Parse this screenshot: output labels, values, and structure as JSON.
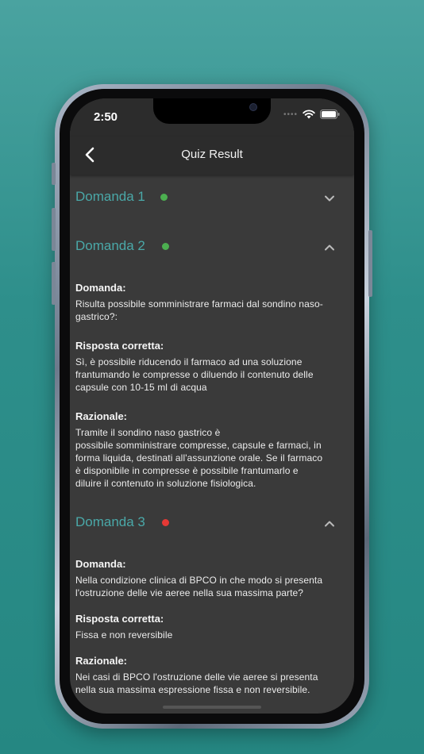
{
  "status": {
    "time": "2:50"
  },
  "nav": {
    "title": "Quiz Result"
  },
  "colors": {
    "correct": "#4caf50",
    "wrong": "#e53935",
    "accent": "#4aa8a8"
  },
  "labels": {
    "question": "Domanda:",
    "correct_answer": "Risposta corretta:",
    "rationale": "Razionale:"
  },
  "questions": [
    {
      "title": "Domanda 1",
      "status": "correct",
      "expanded": false
    },
    {
      "title": "Domanda 2",
      "status": "correct",
      "expanded": true,
      "question_lines": [
        "Risulta possibile somministrare farmaci dal sondino naso-",
        "gastrico?:"
      ],
      "answer_lines": [
        "Sì, è possibile riducendo il farmaco ad una soluzione",
        "frantumando le compresse o diluendo il contenuto delle",
        "capsule con 10-15 ml di acqua"
      ],
      "rationale_lines": [
        "Tramite il sondino naso gastrico è",
        "possibile somministrare compresse, capsule e farmaci, in",
        "forma liquida, destinati all'assunzione orale. Se il farmaco",
        "è disponibile in compresse è possibile frantumarlo e",
        "diluire il contenuto in soluzione fisiologica."
      ]
    },
    {
      "title": "Domanda 3",
      "status": "wrong",
      "expanded": true,
      "question_lines": [
        "Nella condizione clinica di BPCO in che modo si presenta",
        "l'ostruzione delle vie aeree nella sua massima parte?"
      ],
      "answer_lines": [
        "Fissa e non reversibile"
      ],
      "rationale_lines": [
        "Nei casi di BPCO l'ostruzione delle vie aeree si presenta",
        "nella sua massima espressione fissa e non reversibile."
      ]
    }
  ]
}
